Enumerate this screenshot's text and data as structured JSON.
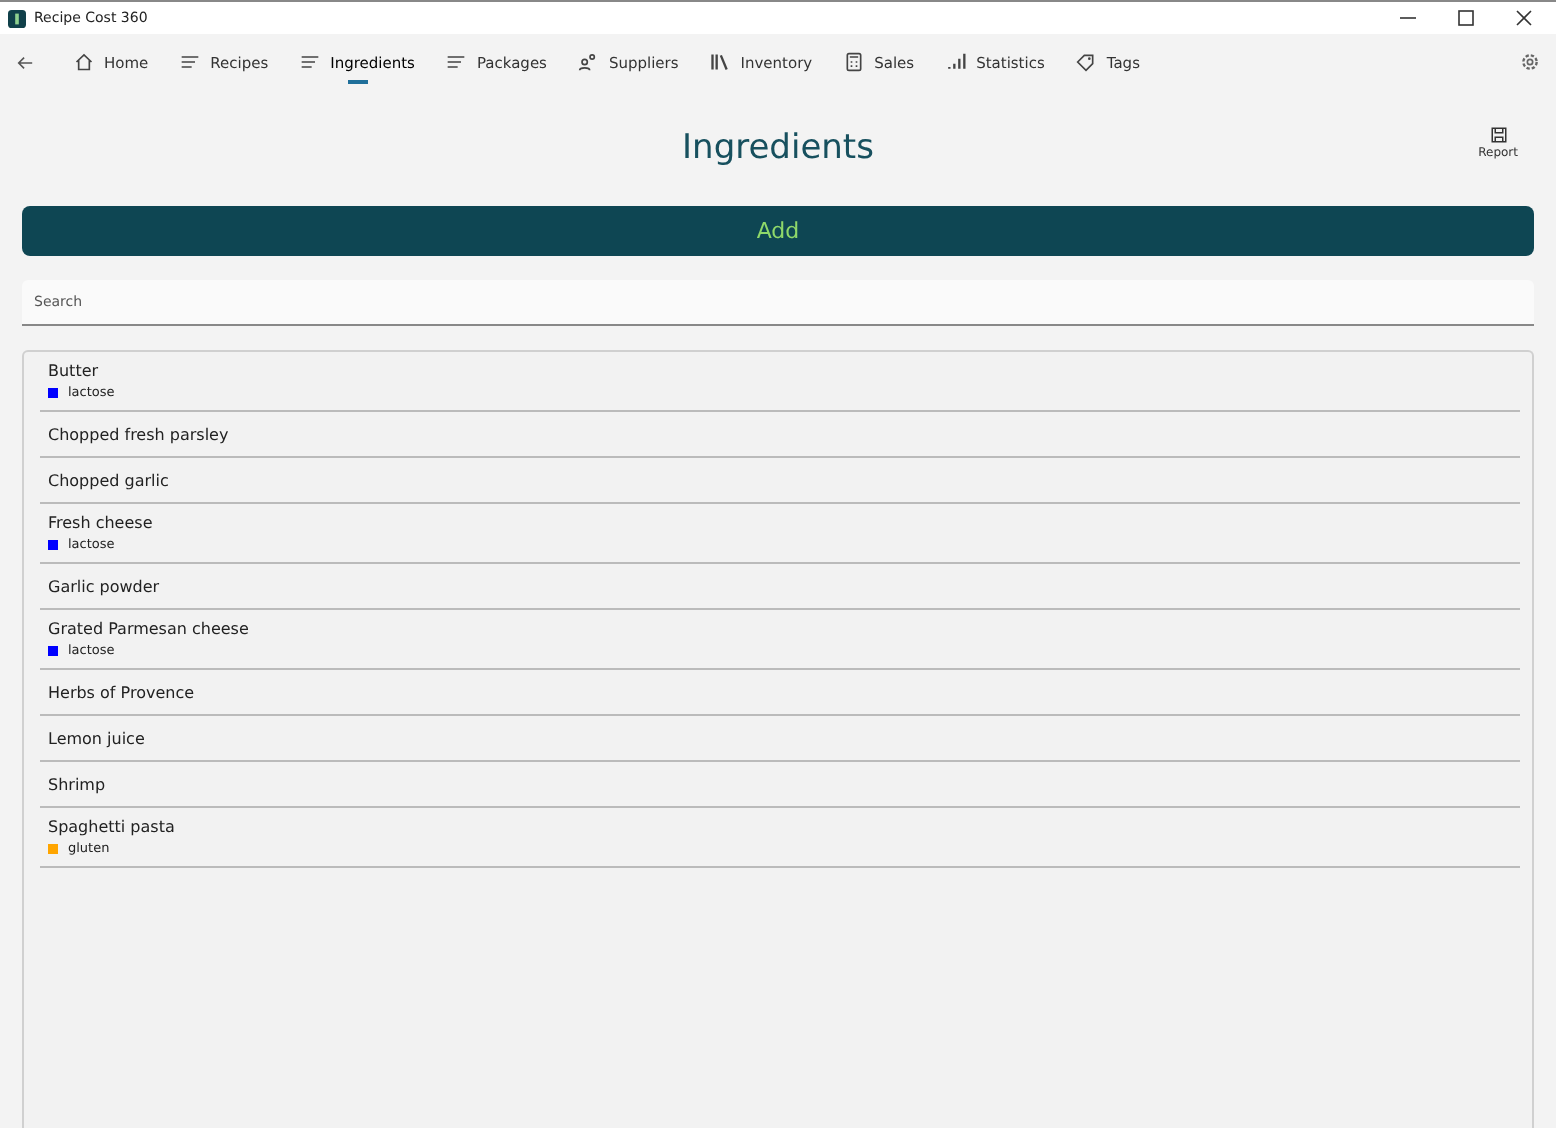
{
  "window": {
    "title": "Recipe Cost 360"
  },
  "tabs": [
    {
      "label": "Home",
      "kind": "home",
      "selected": false
    },
    {
      "label": "Recipes",
      "kind": "list",
      "selected": false
    },
    {
      "label": "Ingredients",
      "kind": "list",
      "selected": true
    },
    {
      "label": "Packages",
      "kind": "list",
      "selected": false
    },
    {
      "label": "Suppliers",
      "kind": "people",
      "selected": false
    },
    {
      "label": "Inventory",
      "kind": "books",
      "selected": false
    },
    {
      "label": "Sales",
      "kind": "calculator",
      "selected": false
    },
    {
      "label": "Statistics",
      "kind": "chart",
      "selected": false
    },
    {
      "label": "Tags",
      "kind": "tag",
      "selected": false
    }
  ],
  "page": {
    "title": "Ingredients",
    "report_label": "Report",
    "add_label": "Add",
    "search_placeholder": "Search"
  },
  "ingredients": [
    {
      "name": "Butter",
      "tags": [
        {
          "label": "lactose",
          "color": "#0000ff"
        }
      ]
    },
    {
      "name": "Chopped fresh parsley"
    },
    {
      "name": "Chopped garlic"
    },
    {
      "name": "Fresh cheese",
      "tags": [
        {
          "label": "lactose",
          "color": "#0000ff"
        }
      ]
    },
    {
      "name": "Garlic powder"
    },
    {
      "name": "Grated Parmesan cheese",
      "tags": [
        {
          "label": "lactose",
          "color": "#0000ff"
        }
      ]
    },
    {
      "name": "Herbs of Provence"
    },
    {
      "name": "Lemon juice"
    },
    {
      "name": "Shrimp"
    },
    {
      "name": "Spaghetti pasta",
      "tags": [
        {
          "label": "gluten",
          "color": "#ffa500"
        }
      ]
    }
  ]
}
